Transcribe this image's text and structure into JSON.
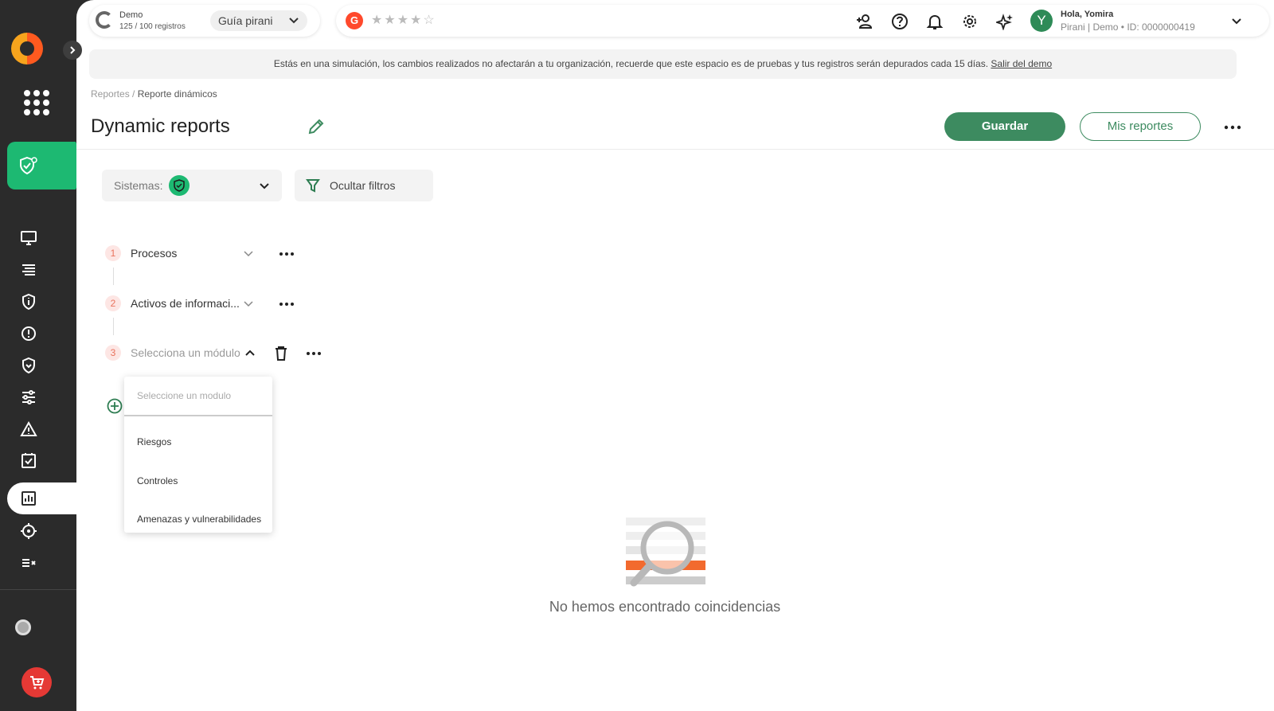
{
  "sidebar": {
    "icons": [
      "monitor-icon",
      "list-icon",
      "shield-info-icon",
      "alert-circle-icon",
      "shield-down-icon",
      "sliders-icon",
      "warning-icon",
      "checklist-icon",
      "report-icon",
      "target-icon",
      "compare-icon"
    ],
    "active": "report-icon"
  },
  "topbar": {
    "demo_title": "Demo",
    "demo_registros": "125 / 100 registros",
    "guide_label": "Guía pirani",
    "g2_label": "G",
    "stars": "★★★★☆",
    "avatar_initial": "Y",
    "user_greeting": "Hola, Yomira",
    "user_sub": "Pirani | Demo • ID: 0000000419"
  },
  "banner": {
    "text": "Estás en una simulación, los cambios realizados no afectarán a tu organización, recuerde que este espacio es de pruebas y tus registros serán depurados cada 15 días.",
    "link": "Salir del demo"
  },
  "breadcrumb": {
    "parent": "Reportes /",
    "current": "Reporte dinámicos"
  },
  "page": {
    "title": "Dynamic reports",
    "save_label": "Guardar",
    "my_reports_label": "Mis reportes"
  },
  "filters": {
    "systems_label": "Sistemas:",
    "hide_filters_label": "Ocultar filtros"
  },
  "steps": [
    {
      "num": "1",
      "label": "Procesos"
    },
    {
      "num": "2",
      "label": "Activos de informaci..."
    },
    {
      "num": "3",
      "label": "Selecciona un módulo"
    }
  ],
  "dropdown": {
    "placeholder": "Seleccione un modulo",
    "options": [
      "Riesgos",
      "Controles",
      "Amenazas y vulnerabilidades"
    ]
  },
  "empty": {
    "message": "No hemos encontrado coincidencias"
  },
  "colors": {
    "primary": "#3d8b60",
    "accent": "#1db972",
    "sidebar": "#2b2b2b",
    "step_badge": "#e9735d"
  }
}
